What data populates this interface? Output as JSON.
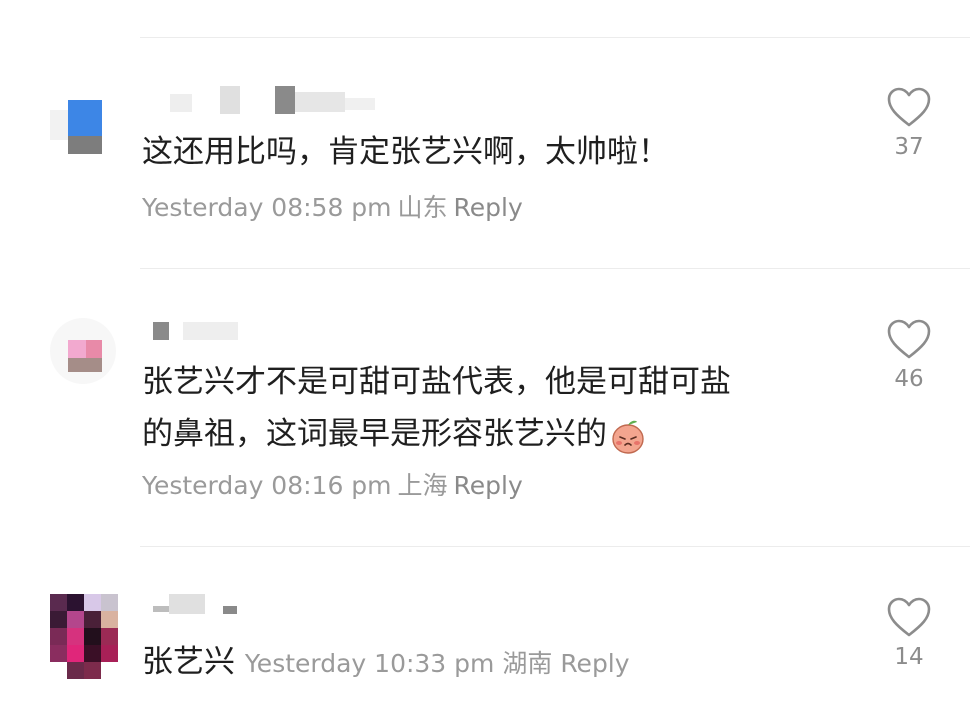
{
  "comments": [
    {
      "text_lines": [
        "这还用比吗，肯定张艺兴啊，太帅啦！"
      ],
      "time": "Yesterday 08:58 pm",
      "location": "山东",
      "reply_label": "Reply",
      "likes": "37"
    },
    {
      "text_lines": [
        "张艺兴才不是可甜可盐代表，他是可甜可盐",
        "的鼻祖，这词最早是形容张艺兴的"
      ],
      "emoji": "peach-emoji-icon",
      "time": "Yesterday 08:16 pm",
      "location": "上海",
      "reply_label": "Reply",
      "likes": "46"
    },
    {
      "text_lines": [
        "张艺兴"
      ],
      "time": "Yesterday 10:33 pm",
      "location": "湖南",
      "reply_label": "Reply",
      "likes": "14"
    }
  ],
  "colors": {
    "text": "#1f1f1f",
    "meta": "#9a9a9a",
    "divider": "#ececec",
    "heart_stroke": "#8c8c8c"
  },
  "icons": {
    "like": "heart-outline-icon"
  }
}
